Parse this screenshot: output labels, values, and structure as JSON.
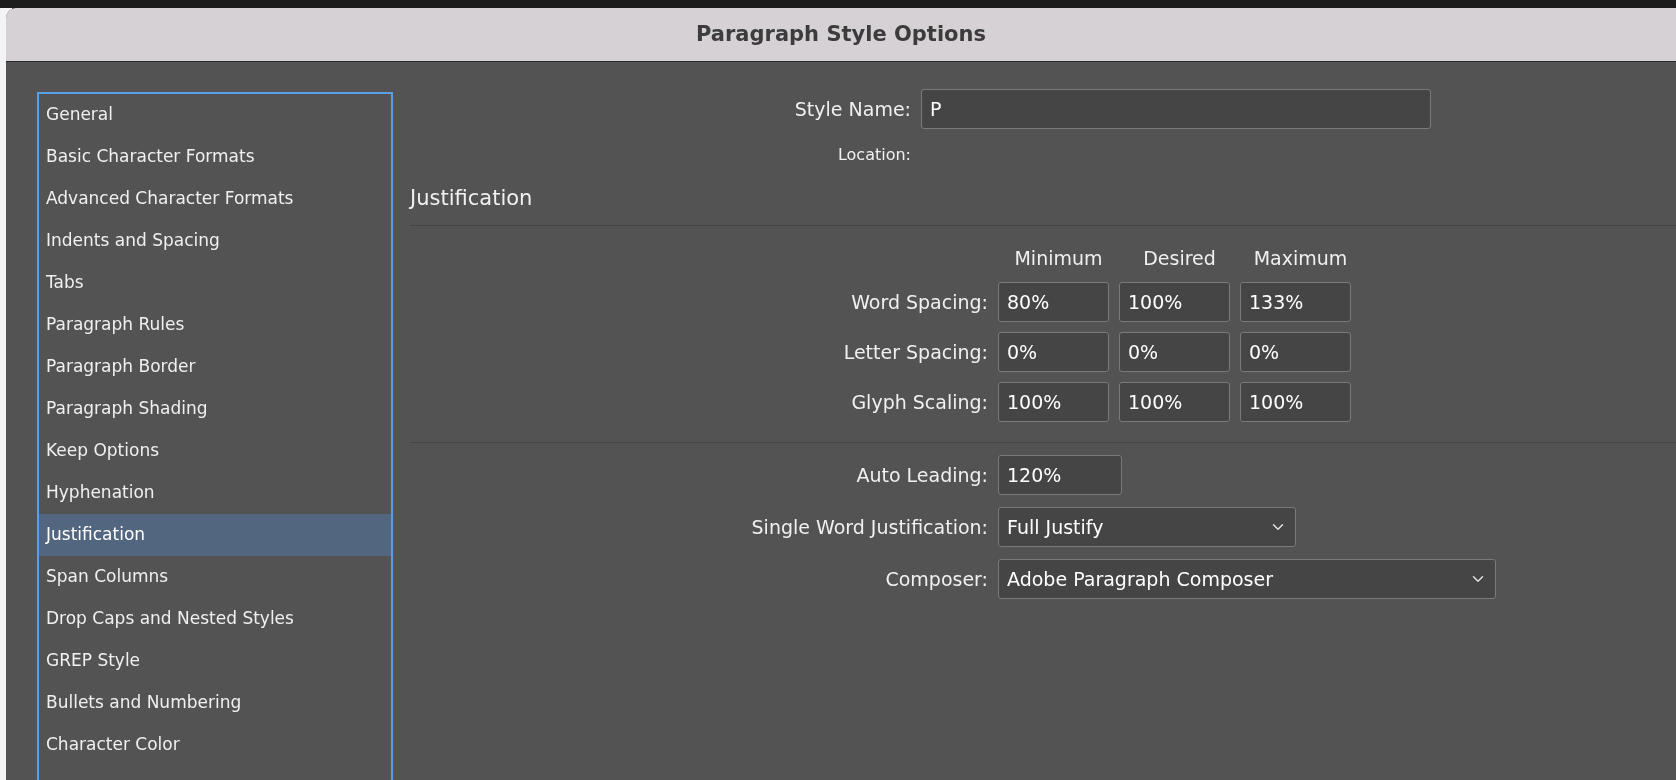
{
  "window": {
    "title": "Paragraph Style Options"
  },
  "sidebar": {
    "items": [
      {
        "label": "General",
        "selected": false
      },
      {
        "label": "Basic Character Formats",
        "selected": false
      },
      {
        "label": "Advanced Character Formats",
        "selected": false
      },
      {
        "label": "Indents and Spacing",
        "selected": false
      },
      {
        "label": "Tabs",
        "selected": false
      },
      {
        "label": "Paragraph Rules",
        "selected": false
      },
      {
        "label": "Paragraph Border",
        "selected": false
      },
      {
        "label": "Paragraph Shading",
        "selected": false
      },
      {
        "label": "Keep Options",
        "selected": false
      },
      {
        "label": "Hyphenation",
        "selected": false
      },
      {
        "label": "Justification",
        "selected": true
      },
      {
        "label": "Span Columns",
        "selected": false
      },
      {
        "label": "Drop Caps and Nested Styles",
        "selected": false
      },
      {
        "label": "GREP Style",
        "selected": false
      },
      {
        "label": "Bullets and Numbering",
        "selected": false
      },
      {
        "label": "Character Color",
        "selected": false
      }
    ]
  },
  "style_name": {
    "label": "Style Name:",
    "value": "P"
  },
  "location": {
    "label": "Location:"
  },
  "section_title": "Justification",
  "spacing_table": {
    "columns": [
      "Minimum",
      "Desired",
      "Maximum"
    ],
    "rows": [
      {
        "label": "Word Spacing:",
        "values": [
          "80%",
          "100%",
          "133%"
        ]
      },
      {
        "label": "Letter Spacing:",
        "values": [
          "0%",
          "0%",
          "0%"
        ]
      },
      {
        "label": "Glyph Scaling:",
        "values": [
          "100%",
          "100%",
          "100%"
        ]
      }
    ]
  },
  "auto_leading": {
    "label": "Auto Leading:",
    "value": "120%"
  },
  "single_word_justification": {
    "label": "Single Word Justification:",
    "value": "Full Justify"
  },
  "composer": {
    "label": "Composer:",
    "value": "Adobe Paragraph Composer"
  }
}
